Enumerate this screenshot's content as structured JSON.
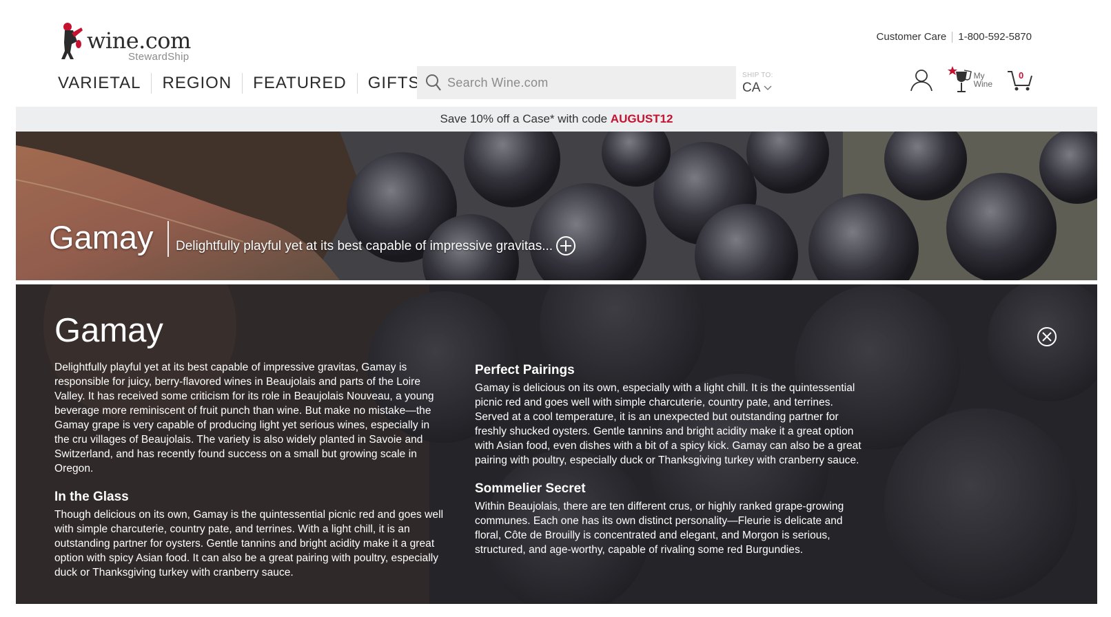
{
  "header": {
    "logo_text": "wine.com",
    "logo_sub": "StewardShip",
    "customer_care": "Customer Care",
    "phone": "1-800-592-5870",
    "nav": [
      "VARIETAL",
      "REGION",
      "FEATURED",
      "GIFTS"
    ],
    "search_placeholder": "Search Wine.com",
    "ship_label": "SHIP TO:",
    "ship_value": "CA",
    "my_wine_line1": "My",
    "my_wine_line2": "Wine",
    "cart_count": "0"
  },
  "promo": {
    "text": "Save 10% off a Case* with code",
    "code": "AUGUST12"
  },
  "hero": {
    "title": "Gamay",
    "tagline": "Delightfully playful yet at its best capable of impressive gravitas..."
  },
  "panel": {
    "title": "Gamay",
    "intro": "Delightfully playful yet at its best capable of impressive gravitas, Gamay is responsible for juicy, berry-flavored wines in Beaujolais and parts of the Loire Valley. It has received some criticism for its role in Beaujolais Nouveau, a young beverage more reminiscent of fruit punch than wine. But make no mistake—the Gamay grape is very capable of producing light yet serious wines, especially in the cru villages of Beaujolais. The variety is also widely planted in Savoie and Switzerland, and has recently found success on a small but growing scale in Oregon.",
    "glass_heading": "In the Glass",
    "glass_text": "Though delicious on its own, Gamay is the quintessential picnic red and goes well with simple charcuterie, country pate, and terrines. With a light chill, it is an outstanding partner for oysters. Gentle tannins and bright acidity make it a great option with spicy Asian food. It can also be a great pairing with poultry, especially duck or Thanksgiving turkey with cranberry sauce.",
    "pairings_heading": "Perfect Pairings",
    "pairings_text": "Gamay is delicious on its own, especially with a light chill. It is the quintessential picnic red and goes well with simple charcuterie, country pate, and terrines. Served at a cool temperature, it is an unexpected but outstanding partner for freshly shucked oysters. Gentle tannins and bright acidity make it a great option with Asian food, even dishes with a bit of a spicy kick. Gamay can also be a great pairing with poultry, especially duck or Thanksgiving turkey with cranberry sauce.",
    "secret_heading": "Sommelier Secret",
    "secret_text": "Within Beaujolais, there are ten different crus, or highly ranked grape-growing communes. Each one has its own distinct personality—Fleurie is delicate and floral, Côte de Brouilly is concentrated and elegant, and Morgon is serious, structured, and age-worthy, capable of rivaling some red Burgundies."
  },
  "colors": {
    "accent_red": "#c41230",
    "promo_bg": "#eceeef",
    "search_bg": "#eeeeee"
  }
}
